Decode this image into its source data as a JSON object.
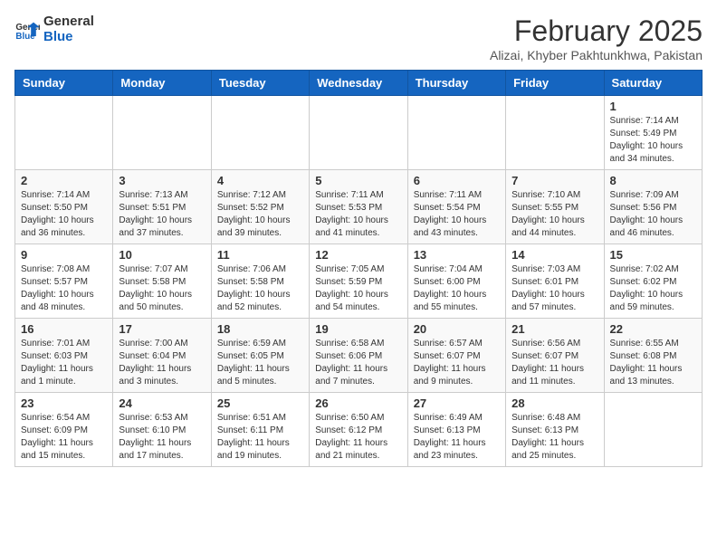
{
  "header": {
    "logo_general": "General",
    "logo_blue": "Blue",
    "month_title": "February 2025",
    "location": "Alizai, Khyber Pakhtunkhwa, Pakistan"
  },
  "weekdays": [
    "Sunday",
    "Monday",
    "Tuesday",
    "Wednesday",
    "Thursday",
    "Friday",
    "Saturday"
  ],
  "weeks": [
    [
      {
        "day": "",
        "info": ""
      },
      {
        "day": "",
        "info": ""
      },
      {
        "day": "",
        "info": ""
      },
      {
        "day": "",
        "info": ""
      },
      {
        "day": "",
        "info": ""
      },
      {
        "day": "",
        "info": ""
      },
      {
        "day": "1",
        "info": "Sunrise: 7:14 AM\nSunset: 5:49 PM\nDaylight: 10 hours\nand 34 minutes."
      }
    ],
    [
      {
        "day": "2",
        "info": "Sunrise: 7:14 AM\nSunset: 5:50 PM\nDaylight: 10 hours\nand 36 minutes."
      },
      {
        "day": "3",
        "info": "Sunrise: 7:13 AM\nSunset: 5:51 PM\nDaylight: 10 hours\nand 37 minutes."
      },
      {
        "day": "4",
        "info": "Sunrise: 7:12 AM\nSunset: 5:52 PM\nDaylight: 10 hours\nand 39 minutes."
      },
      {
        "day": "5",
        "info": "Sunrise: 7:11 AM\nSunset: 5:53 PM\nDaylight: 10 hours\nand 41 minutes."
      },
      {
        "day": "6",
        "info": "Sunrise: 7:11 AM\nSunset: 5:54 PM\nDaylight: 10 hours\nand 43 minutes."
      },
      {
        "day": "7",
        "info": "Sunrise: 7:10 AM\nSunset: 5:55 PM\nDaylight: 10 hours\nand 44 minutes."
      },
      {
        "day": "8",
        "info": "Sunrise: 7:09 AM\nSunset: 5:56 PM\nDaylight: 10 hours\nand 46 minutes."
      }
    ],
    [
      {
        "day": "9",
        "info": "Sunrise: 7:08 AM\nSunset: 5:57 PM\nDaylight: 10 hours\nand 48 minutes."
      },
      {
        "day": "10",
        "info": "Sunrise: 7:07 AM\nSunset: 5:58 PM\nDaylight: 10 hours\nand 50 minutes."
      },
      {
        "day": "11",
        "info": "Sunrise: 7:06 AM\nSunset: 5:58 PM\nDaylight: 10 hours\nand 52 minutes."
      },
      {
        "day": "12",
        "info": "Sunrise: 7:05 AM\nSunset: 5:59 PM\nDaylight: 10 hours\nand 54 minutes."
      },
      {
        "day": "13",
        "info": "Sunrise: 7:04 AM\nSunset: 6:00 PM\nDaylight: 10 hours\nand 55 minutes."
      },
      {
        "day": "14",
        "info": "Sunrise: 7:03 AM\nSunset: 6:01 PM\nDaylight: 10 hours\nand 57 minutes."
      },
      {
        "day": "15",
        "info": "Sunrise: 7:02 AM\nSunset: 6:02 PM\nDaylight: 10 hours\nand 59 minutes."
      }
    ],
    [
      {
        "day": "16",
        "info": "Sunrise: 7:01 AM\nSunset: 6:03 PM\nDaylight: 11 hours\nand 1 minute."
      },
      {
        "day": "17",
        "info": "Sunrise: 7:00 AM\nSunset: 6:04 PM\nDaylight: 11 hours\nand 3 minutes."
      },
      {
        "day": "18",
        "info": "Sunrise: 6:59 AM\nSunset: 6:05 PM\nDaylight: 11 hours\nand 5 minutes."
      },
      {
        "day": "19",
        "info": "Sunrise: 6:58 AM\nSunset: 6:06 PM\nDaylight: 11 hours\nand 7 minutes."
      },
      {
        "day": "20",
        "info": "Sunrise: 6:57 AM\nSunset: 6:07 PM\nDaylight: 11 hours\nand 9 minutes."
      },
      {
        "day": "21",
        "info": "Sunrise: 6:56 AM\nSunset: 6:07 PM\nDaylight: 11 hours\nand 11 minutes."
      },
      {
        "day": "22",
        "info": "Sunrise: 6:55 AM\nSunset: 6:08 PM\nDaylight: 11 hours\nand 13 minutes."
      }
    ],
    [
      {
        "day": "23",
        "info": "Sunrise: 6:54 AM\nSunset: 6:09 PM\nDaylight: 11 hours\nand 15 minutes."
      },
      {
        "day": "24",
        "info": "Sunrise: 6:53 AM\nSunset: 6:10 PM\nDaylight: 11 hours\nand 17 minutes."
      },
      {
        "day": "25",
        "info": "Sunrise: 6:51 AM\nSunset: 6:11 PM\nDaylight: 11 hours\nand 19 minutes."
      },
      {
        "day": "26",
        "info": "Sunrise: 6:50 AM\nSunset: 6:12 PM\nDaylight: 11 hours\nand 21 minutes."
      },
      {
        "day": "27",
        "info": "Sunrise: 6:49 AM\nSunset: 6:13 PM\nDaylight: 11 hours\nand 23 minutes."
      },
      {
        "day": "28",
        "info": "Sunrise: 6:48 AM\nSunset: 6:13 PM\nDaylight: 11 hours\nand 25 minutes."
      },
      {
        "day": "",
        "info": ""
      }
    ]
  ]
}
